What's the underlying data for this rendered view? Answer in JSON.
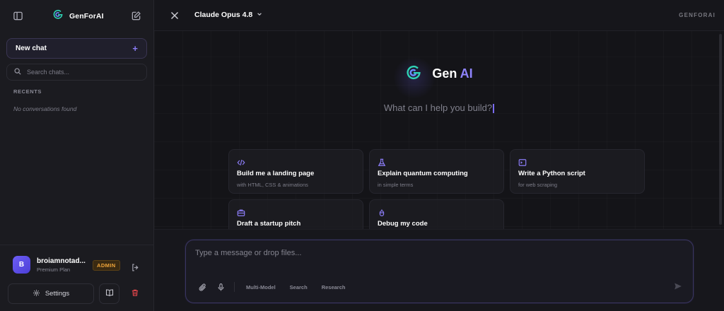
{
  "sidebar": {
    "brand_name": "GenForAI",
    "new_chat_label": "New chat",
    "new_chat_plus": "+",
    "search_placeholder": "Search chats...",
    "recents_label": "RECENTS",
    "empty_label": "No conversations found",
    "user": {
      "avatar_letter": "B",
      "name": "broiamnotad...",
      "plan": "Premium Plan",
      "badge": "ADMIN"
    },
    "settings_label": "Settings"
  },
  "topbar": {
    "model_name": "Claude Opus 4.8",
    "brand_tag": "GENFORAI"
  },
  "hero": {
    "title_main": "Gen",
    "title_accent": "AI",
    "prompt": "What can I help you build?"
  },
  "suggestions": [
    {
      "icon": "code-icon",
      "title": "Build me a landing page",
      "subtitle": "with HTML, CSS & animations"
    },
    {
      "icon": "flask-icon",
      "title": "Explain quantum computing",
      "subtitle": "in simple terms"
    },
    {
      "icon": "terminal-icon",
      "title": "Write a Python script",
      "subtitle": "for web scraping"
    },
    {
      "icon": "briefcase-icon",
      "title": "Draft a startup pitch",
      "subtitle": ""
    },
    {
      "icon": "bug-icon",
      "title": "Debug my code",
      "subtitle": ""
    }
  ],
  "composer": {
    "placeholder": "Type a message or drop files...",
    "chips": [
      "Multi-Model",
      "Search",
      "Research"
    ]
  },
  "colors": {
    "accent": "#8b7cf6",
    "admin_badge": "#f0a53a",
    "danger": "#e0454a",
    "logo_teal": "#2fd3b5"
  }
}
